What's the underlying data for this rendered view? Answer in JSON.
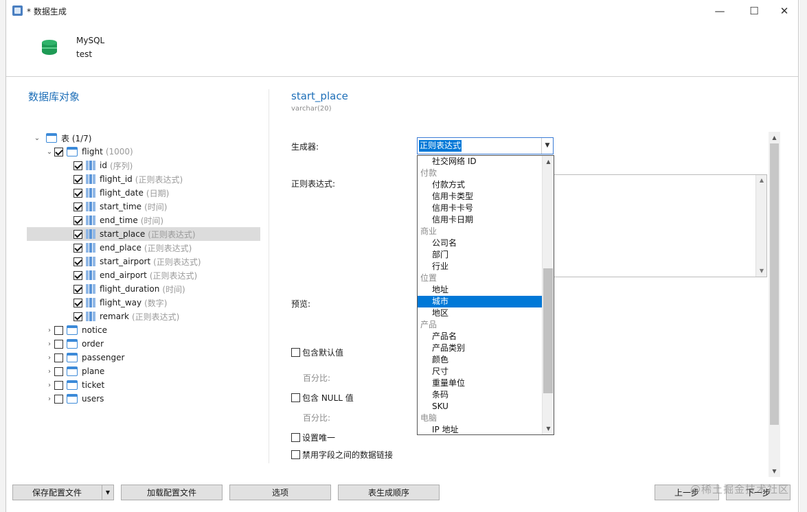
{
  "window": {
    "title": "* 数据生成",
    "minimize": "—",
    "maximize": "☐",
    "close": "✕"
  },
  "connection": {
    "type": "MySQL",
    "database": "test"
  },
  "left": {
    "section_title": "数据库对象",
    "tree": [
      {
        "level": 0,
        "expand": "⌄",
        "check": null,
        "icon": "table",
        "name": "表 (1/7)",
        "hint": "",
        "sel": false
      },
      {
        "level": 1,
        "expand": "⌄",
        "check": true,
        "icon": "table",
        "name": "flight",
        "hint": "(1000)",
        "sel": false
      },
      {
        "level": 2,
        "expand": "",
        "check": true,
        "icon": "column",
        "name": "id",
        "hint": "(序列)",
        "sel": false
      },
      {
        "level": 2,
        "expand": "",
        "check": true,
        "icon": "column",
        "name": "flight_id",
        "hint": "(正则表达式)",
        "sel": false
      },
      {
        "level": 2,
        "expand": "",
        "check": true,
        "icon": "column",
        "name": "flight_date",
        "hint": "(日期)",
        "sel": false
      },
      {
        "level": 2,
        "expand": "",
        "check": true,
        "icon": "column",
        "name": "start_time",
        "hint": "(时间)",
        "sel": false
      },
      {
        "level": 2,
        "expand": "",
        "check": true,
        "icon": "column",
        "name": "end_time",
        "hint": "(时间)",
        "sel": false
      },
      {
        "level": 2,
        "expand": "",
        "check": true,
        "icon": "column",
        "name": "start_place",
        "hint": "(正则表达式)",
        "sel": true
      },
      {
        "level": 2,
        "expand": "",
        "check": true,
        "icon": "column",
        "name": "end_place",
        "hint": "(正则表达式)",
        "sel": false
      },
      {
        "level": 2,
        "expand": "",
        "check": true,
        "icon": "column",
        "name": "start_airport",
        "hint": "(正则表达式)",
        "sel": false
      },
      {
        "level": 2,
        "expand": "",
        "check": true,
        "icon": "column",
        "name": "end_airport",
        "hint": "(正则表达式)",
        "sel": false
      },
      {
        "level": 2,
        "expand": "",
        "check": true,
        "icon": "column",
        "name": "flight_duration",
        "hint": "(时间)",
        "sel": false
      },
      {
        "level": 2,
        "expand": "",
        "check": true,
        "icon": "column",
        "name": "flight_way",
        "hint": "(数字)",
        "sel": false
      },
      {
        "level": 2,
        "expand": "",
        "check": true,
        "icon": "column",
        "name": "remark",
        "hint": "(正则表达式)",
        "sel": false
      },
      {
        "level": 1,
        "expand": "›",
        "check": false,
        "icon": "table",
        "name": "notice",
        "hint": "",
        "sel": false
      },
      {
        "level": 1,
        "expand": "›",
        "check": false,
        "icon": "table",
        "name": "order",
        "hint": "",
        "sel": false
      },
      {
        "level": 1,
        "expand": "›",
        "check": false,
        "icon": "table",
        "name": "passenger",
        "hint": "",
        "sel": false
      },
      {
        "level": 1,
        "expand": "›",
        "check": false,
        "icon": "table",
        "name": "plane",
        "hint": "",
        "sel": false
      },
      {
        "level": 1,
        "expand": "›",
        "check": false,
        "icon": "table",
        "name": "ticket",
        "hint": "",
        "sel": false
      },
      {
        "level": 1,
        "expand": "›",
        "check": false,
        "icon": "table",
        "name": "users",
        "hint": "",
        "sel": false
      }
    ]
  },
  "right": {
    "field_name": "start_place",
    "field_type": "varchar(20)",
    "generator_label": "生成器:",
    "generator_value": "正则表达式",
    "regex_label": "正则表达式:",
    "preview_label": "预览:",
    "include_default": "包含默认值",
    "percent_label_1": "百分比:",
    "include_null": "包含 NULL 值",
    "percent_label_2": "百分比:",
    "set_unique": "设置唯一",
    "disable_link": "禁用字段之间的数据链接"
  },
  "dropdown": {
    "items": [
      {
        "kind": "opt",
        "text": "社交网络 ID",
        "sel": false
      },
      {
        "kind": "cat",
        "text": "付款",
        "sel": false
      },
      {
        "kind": "opt",
        "text": "付款方式",
        "sel": false
      },
      {
        "kind": "opt",
        "text": "信用卡类型",
        "sel": false
      },
      {
        "kind": "opt",
        "text": "信用卡卡号",
        "sel": false
      },
      {
        "kind": "opt",
        "text": "信用卡日期",
        "sel": false
      },
      {
        "kind": "cat",
        "text": "商业",
        "sel": false
      },
      {
        "kind": "opt",
        "text": "公司名",
        "sel": false
      },
      {
        "kind": "opt",
        "text": "部门",
        "sel": false
      },
      {
        "kind": "opt",
        "text": "行业",
        "sel": false
      },
      {
        "kind": "cat",
        "text": "位置",
        "sel": false
      },
      {
        "kind": "opt",
        "text": "地址",
        "sel": false
      },
      {
        "kind": "opt",
        "text": "城市",
        "sel": true
      },
      {
        "kind": "opt",
        "text": "地区",
        "sel": false
      },
      {
        "kind": "cat",
        "text": "产品",
        "sel": false
      },
      {
        "kind": "opt",
        "text": "产品名",
        "sel": false
      },
      {
        "kind": "opt",
        "text": "产品类别",
        "sel": false
      },
      {
        "kind": "opt",
        "text": "颜色",
        "sel": false
      },
      {
        "kind": "opt",
        "text": "尺寸",
        "sel": false
      },
      {
        "kind": "opt",
        "text": "重量单位",
        "sel": false
      },
      {
        "kind": "opt",
        "text": "条码",
        "sel": false
      },
      {
        "kind": "opt",
        "text": "SKU",
        "sel": false
      },
      {
        "kind": "cat",
        "text": "电脑",
        "sel": false
      },
      {
        "kind": "opt",
        "text": "IP 地址",
        "sel": false
      }
    ]
  },
  "footer": {
    "save_config": "保存配置文件",
    "load_config": "加载配置文件",
    "options": "选项",
    "table_order": "表生成顺序",
    "prev": "上一步",
    "next": "下一步"
  },
  "watermark": "@稀土掘金技术社区"
}
